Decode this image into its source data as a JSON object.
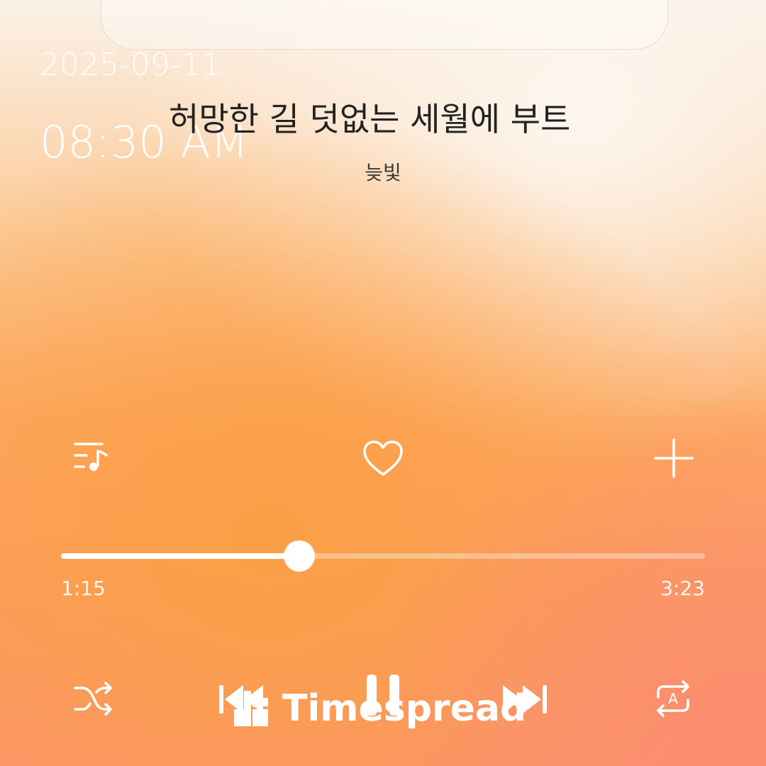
{
  "status": {
    "date": "2025-09-11",
    "time": "08:30 AM"
  },
  "track": {
    "title": "허망한 길  덧없는 세월에 부트",
    "artist": "늦빛"
  },
  "actions": {
    "playlist_icon": "playlist-music-icon",
    "like_icon": "heart-outline-icon",
    "add_icon": "plus-icon"
  },
  "progress": {
    "elapsed": "1:15",
    "total": "3:23",
    "fraction": 0.37
  },
  "controls": {
    "shuffle_icon": "shuffle-icon",
    "previous_icon": "skip-previous-icon",
    "pause_icon": "pause-icon",
    "next_icon": "skip-next-icon",
    "repeat_icon": "repeat-icon",
    "repeat_mode": "A"
  },
  "watermark": {
    "brand": "Timespread"
  },
  "colors": {
    "accent": "#ffffff",
    "text_dark": "#222222",
    "gradient_warm": "#fb9f45"
  }
}
